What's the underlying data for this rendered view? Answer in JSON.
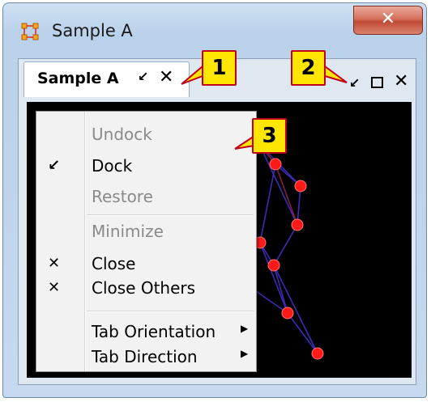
{
  "window": {
    "title": "Sample A",
    "close_glyph": "✕"
  },
  "tab": {
    "label": "Sample A",
    "dock_glyph": "↙",
    "close_glyph": "✕"
  },
  "panel_controls": {
    "dock_glyph": "↙",
    "close_glyph": "✕"
  },
  "callouts": [
    "1",
    "2",
    "3"
  ],
  "menu": {
    "items": [
      {
        "label": "Undock",
        "icon": "",
        "enabled": false
      },
      {
        "label": "Dock",
        "icon": "↙",
        "enabled": true
      },
      {
        "label": "Restore",
        "icon": "",
        "enabled": false
      },
      {
        "label": "Minimize",
        "icon": "",
        "enabled": false
      },
      {
        "label": "Close",
        "icon": "✕",
        "enabled": true
      },
      {
        "label": "Close Others",
        "icon": "✕",
        "enabled": true
      },
      {
        "label": "Tab Orientation",
        "icon": "",
        "enabled": true,
        "submenu": "▶"
      },
      {
        "label": "Tab Direction",
        "icon": "",
        "enabled": true,
        "submenu": "▶"
      }
    ]
  },
  "colors": {
    "callout_fill": "#ffe600",
    "callout_border": "#c0001a",
    "node": "#ff1a1a",
    "edge": "#3b2bb5",
    "canvas": "#000000"
  }
}
